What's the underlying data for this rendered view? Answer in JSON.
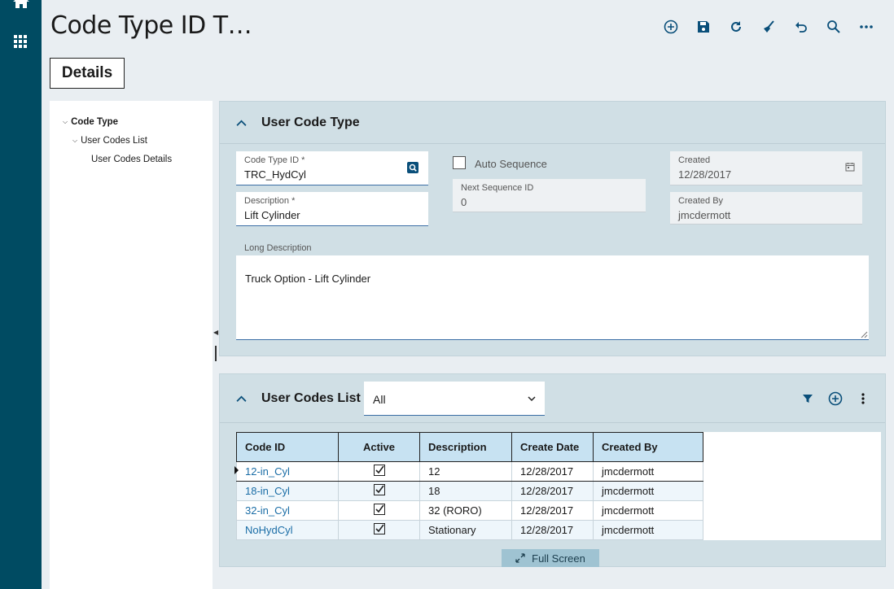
{
  "app": {
    "title": "Code Type ID T…"
  },
  "rail": {
    "home_icon": "home-icon",
    "apps_icon": "apps-grid-icon"
  },
  "toolbar": [
    {
      "name": "add-button",
      "icon": "add-circle-icon"
    },
    {
      "name": "save-button",
      "icon": "save-icon"
    },
    {
      "name": "refresh-button",
      "icon": "refresh-icon"
    },
    {
      "name": "clear-button",
      "icon": "broom-icon"
    },
    {
      "name": "undo-button",
      "icon": "undo-icon"
    },
    {
      "name": "search-button",
      "icon": "search-icon"
    },
    {
      "name": "more-button",
      "icon": "more-horizontal-icon"
    }
  ],
  "tabs": {
    "details": "Details"
  },
  "tree": {
    "items": [
      {
        "label": "Code Type",
        "expanded": true
      },
      {
        "label": "User Codes List",
        "expanded": true
      },
      {
        "label": "User Codes Details"
      }
    ]
  },
  "user_code_type": {
    "title": "User Code Type",
    "code_type_id": {
      "label": "Code Type ID *",
      "value": "TRC_HydCyl"
    },
    "description": {
      "label": "Description *",
      "value": "Lift Cylinder"
    },
    "auto_sequence": {
      "label": "Auto Sequence",
      "checked": false
    },
    "next_sequence": {
      "label": "Next Sequence ID",
      "value": "0"
    },
    "created": {
      "label": "Created",
      "value": "12/28/2017"
    },
    "created_by": {
      "label": "Created By",
      "value": "jmcdermott"
    },
    "long_description": {
      "label": "Long Description",
      "value": "Truck Option - Lift Cylinder"
    }
  },
  "user_codes_list": {
    "title": "User Codes List",
    "filter": {
      "value": "All"
    },
    "columns": [
      "Code ID",
      "Active",
      "Description",
      "Create Date",
      "Created By"
    ],
    "rows": [
      {
        "code_id": "12-in_Cyl",
        "active": true,
        "description": "12",
        "create_date": "12/28/2017",
        "created_by": "jmcdermott"
      },
      {
        "code_id": "18-in_Cyl",
        "active": true,
        "description": "18",
        "create_date": "12/28/2017",
        "created_by": "jmcdermott"
      },
      {
        "code_id": "32-in_Cyl",
        "active": true,
        "description": "32 (RORO)",
        "create_date": "12/28/2017",
        "created_by": "jmcdermott"
      },
      {
        "code_id": "NoHydCyl",
        "active": true,
        "description": "Stationary",
        "create_date": "12/28/2017",
        "created_by": "jmcdermott"
      }
    ],
    "full_screen_label": "Full Screen"
  },
  "colors": {
    "rail": "#004b62",
    "accent": "#0a4f7a",
    "header_bg": "#c7e2f2",
    "panel_bg": "#d0dfe5"
  }
}
